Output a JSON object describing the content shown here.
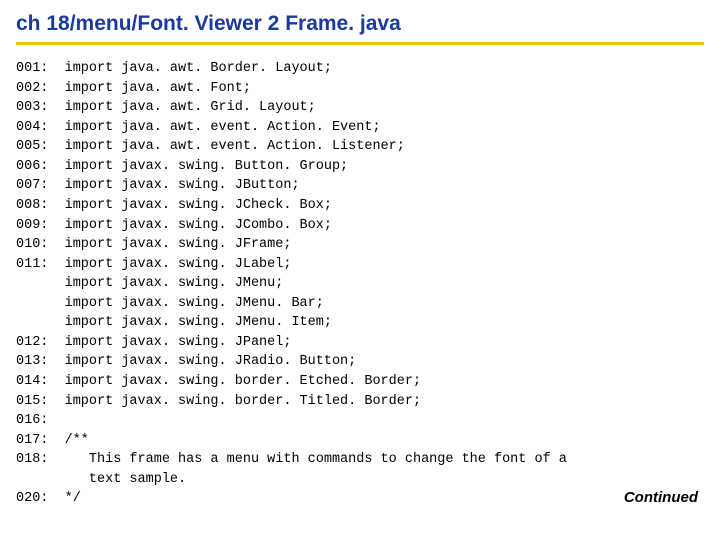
{
  "title": "ch 18/menu/Font. Viewer 2 Frame. java",
  "continued": "Continued",
  "lines": [
    {
      "n": "001:",
      "t": "import java. awt. Border. Layout;"
    },
    {
      "n": "002:",
      "t": "import java. awt. Font;"
    },
    {
      "n": "003:",
      "t": "import java. awt. Grid. Layout;"
    },
    {
      "n": "004:",
      "t": "import java. awt. event. Action. Event;"
    },
    {
      "n": "005:",
      "t": "import java. awt. event. Action. Listener;"
    },
    {
      "n": "006:",
      "t": "import javax. swing. Button. Group;"
    },
    {
      "n": "007:",
      "t": "import javax. swing. JButton;"
    },
    {
      "n": "008:",
      "t": "import javax. swing. JCheck. Box;"
    },
    {
      "n": "009:",
      "t": "import javax. swing. JCombo. Box;"
    },
    {
      "n": "010:",
      "t": "import javax. swing. JFrame;"
    },
    {
      "n": "011:",
      "t": "import javax. swing. JLabel;"
    },
    {
      "n": "",
      "t": "import javax. swing. JMenu;"
    },
    {
      "n": "",
      "t": "import javax. swing. JMenu. Bar;"
    },
    {
      "n": "",
      "t": "import javax. swing. JMenu. Item;"
    },
    {
      "n": "012:",
      "t": "import javax. swing. JPanel;"
    },
    {
      "n": "013:",
      "t": "import javax. swing. JRadio. Button;"
    },
    {
      "n": "014:",
      "t": "import javax. swing. border. Etched. Border;"
    },
    {
      "n": "015:",
      "t": "import javax. swing. border. Titled. Border;"
    },
    {
      "n": "016:",
      "t": ""
    },
    {
      "n": "017:",
      "t": "/**"
    },
    {
      "n": "018:",
      "t": "   This frame has a menu with commands to change the font of a"
    },
    {
      "n": "",
      "t": "   text sample."
    },
    {
      "n": "020:",
      "t": "*/"
    }
  ]
}
